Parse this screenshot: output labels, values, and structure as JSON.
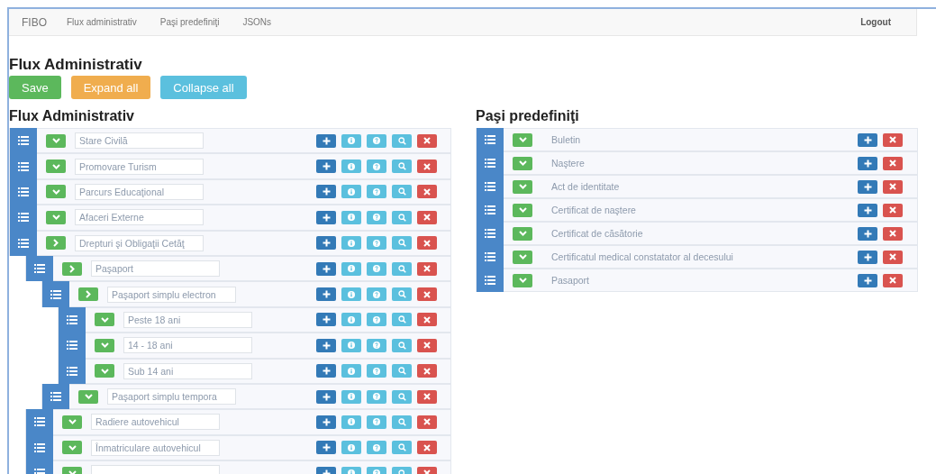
{
  "navbar": {
    "brand": "FIBO",
    "links": [
      "Flux administrativ",
      "Paşi predefiniţi",
      "JSONs"
    ],
    "logout": "Logout"
  },
  "title": "Flux Administrativ",
  "actions": [
    {
      "label": "Save",
      "kind": "success"
    },
    {
      "label": "Expand all",
      "kind": "warning"
    },
    {
      "label": "Collapse all",
      "kind": "info"
    }
  ],
  "tree": {
    "heading": "Flux Administrativ",
    "items": [
      {
        "value": "Stare Civilă",
        "expanded": true
      },
      {
        "value": "Promovare Turism",
        "expanded": true
      },
      {
        "value": "Parcurs Educaţional",
        "expanded": true
      },
      {
        "value": "Afaceri Externe",
        "expanded": true
      },
      {
        "value": "Drepturi şi Obligaţii Cetăţ",
        "expanded": false,
        "children": [
          {
            "value": "Paşaport",
            "expanded": false,
            "children": [
              {
                "value": "Paşaport simplu electron",
                "expanded": false,
                "children": [
                  {
                    "value": "Peste 18 ani",
                    "expanded": true
                  },
                  {
                    "value": "14 - 18 ani",
                    "expanded": true
                  },
                  {
                    "value": "Sub 14 ani",
                    "expanded": true
                  }
                ]
              },
              {
                "value": "Paşaport simplu tempora",
                "expanded": true
              }
            ]
          },
          {
            "value": "Radiere autovehicul",
            "expanded": true
          },
          {
            "value": "Înmatriculare autovehicul",
            "expanded": true
          },
          {
            "expanded": true
          }
        ]
      }
    ]
  },
  "predefined": {
    "heading": "Paşi predefiniţi",
    "items": [
      {
        "label": "Buletin",
        "expanded": true
      },
      {
        "label": "Naştere",
        "expanded": true
      },
      {
        "label": "Act de identitate",
        "expanded": true
      },
      {
        "label": "Certificat de naştere",
        "expanded": true
      },
      {
        "label": "Certificat de căsătorie",
        "expanded": true
      },
      {
        "label": "Certificatul medical constatator al decesului",
        "expanded": true
      },
      {
        "label": "Pasaport",
        "expanded": true
      }
    ]
  }
}
